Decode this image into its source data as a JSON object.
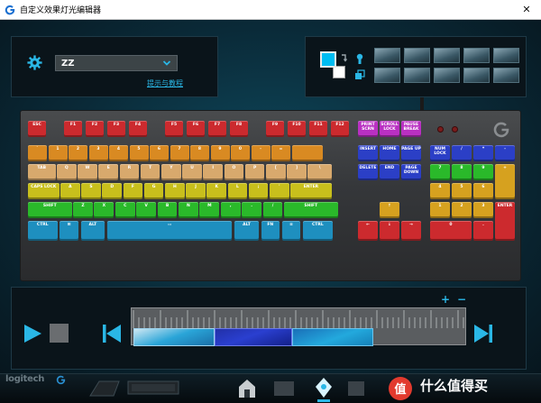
{
  "window": {
    "title": "自定义效果灯光编辑器",
    "close_glyph": "✕"
  },
  "profile": {
    "selected": "ZZ",
    "help_link": "提示与教程"
  },
  "colors": {
    "foreground": "#00bdf2",
    "background": "#ffffff",
    "accent": "#2ab7e6"
  },
  "keyboard": {
    "function_row": [
      "ESC",
      "F1",
      "F2",
      "F3",
      "F4",
      "F5",
      "F6",
      "F7",
      "F8",
      "F9",
      "F10",
      "F11",
      "F12"
    ],
    "system_keys": [
      "PRINT SCRN",
      "SCROLL LOCK",
      "PAUSE BREAK"
    ],
    "number_row": [
      "`",
      "1",
      "2",
      "3",
      "4",
      "5",
      "6",
      "7",
      "8",
      "9",
      "0",
      "-",
      "=",
      ""
    ],
    "top_row": [
      "TAB",
      "Q",
      "W",
      "E",
      "R",
      "T",
      "Y",
      "U",
      "I",
      "O",
      "P",
      "[",
      "]",
      "\\"
    ],
    "home_row": [
      "CAPS LOCK",
      "A",
      "S",
      "D",
      "F",
      "G",
      "H",
      "J",
      "K",
      "L",
      ";",
      "'",
      "ENTER"
    ],
    "shift_row": [
      "SHIFT",
      "Z",
      "X",
      "C",
      "V",
      "B",
      "N",
      "M",
      ",",
      ".",
      "/",
      "SHIFT"
    ],
    "bottom_row": [
      "CTRL",
      "⊞",
      "ALT",
      "▭",
      "ALT",
      "FN",
      "≡",
      "CTRL"
    ],
    "nav_top": [
      "INSERT",
      "HOME",
      "PAGE UP"
    ],
    "nav_bottom": [
      "DELETE",
      "END",
      "PAGE DOWN"
    ],
    "arrows": [
      "↑",
      "←",
      "↓",
      "→"
    ],
    "numpad_row1": [
      "NUM LOCK",
      "/",
      "*",
      "-"
    ],
    "numpad_row2": [
      "7",
      "8",
      "9",
      "+"
    ],
    "numpad_row3": [
      "4",
      "5",
      "6"
    ],
    "numpad_row4": [
      "1",
      "2",
      "3",
      "ENTER"
    ],
    "numpad_row5": [
      "0",
      "."
    ]
  },
  "timeline": {
    "zoom_in": "+",
    "zoom_out": "−"
  },
  "bottombar": {
    "brand": "logitech",
    "watermark": "什么值得买",
    "watermark_badge": "值"
  }
}
